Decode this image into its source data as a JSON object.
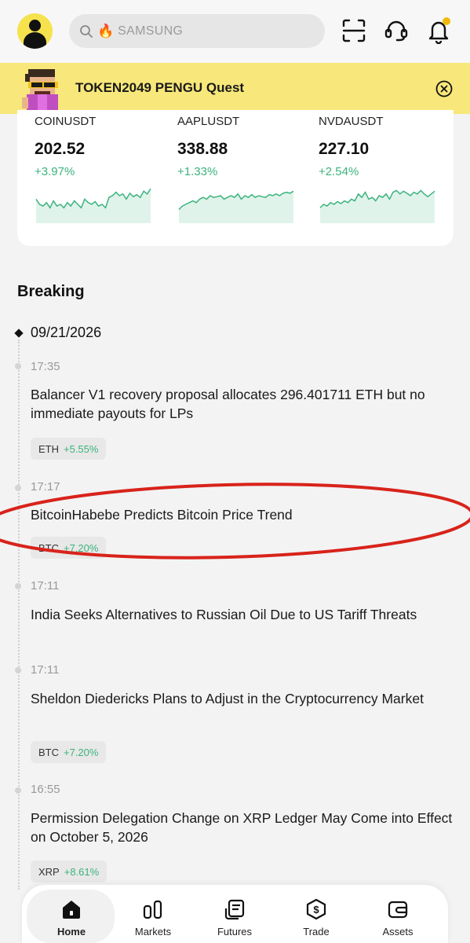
{
  "header": {
    "search_hot_icon": "fire-icon",
    "search_text": "SAMSUNG",
    "icons": [
      "scan-icon",
      "support-headset-icon",
      "bell-icon"
    ],
    "notification_dot_color": "#f0b90b"
  },
  "banner": {
    "text": "TOKEN2049 PENGU Quest",
    "bg_color": "#f8e77a"
  },
  "tickers": [
    {
      "symbol": "COINUSDT",
      "price": "202.52",
      "change": "+3.97%",
      "spark": [
        0.35,
        0.5,
        0.55,
        0.45,
        0.6,
        0.4,
        0.55,
        0.5,
        0.6,
        0.45,
        0.55,
        0.4,
        0.5,
        0.6,
        0.35,
        0.45,
        0.5,
        0.42,
        0.55,
        0.5,
        0.6,
        0.3,
        0.25,
        0.15,
        0.25,
        0.2,
        0.35,
        0.18,
        0.28,
        0.22,
        0.3,
        0.12,
        0.2,
        0.05
      ]
    },
    {
      "symbol": "AAPLUSDT",
      "price": "338.88",
      "change": "+1.33%",
      "spark": [
        0.65,
        0.55,
        0.5,
        0.45,
        0.4,
        0.45,
        0.35,
        0.3,
        0.35,
        0.25,
        0.3,
        0.28,
        0.25,
        0.35,
        0.3,
        0.25,
        0.3,
        0.2,
        0.35,
        0.25,
        0.3,
        0.22,
        0.3,
        0.25,
        0.28,
        0.3,
        0.22,
        0.25,
        0.2,
        0.25,
        0.18,
        0.15,
        0.18,
        0.12
      ]
    },
    {
      "symbol": "NVDAUSDT",
      "price": "227.10",
      "change": "+2.54%",
      "spark": [
        0.6,
        0.5,
        0.55,
        0.45,
        0.5,
        0.42,
        0.48,
        0.4,
        0.45,
        0.35,
        0.4,
        0.2,
        0.3,
        0.15,
        0.35,
        0.3,
        0.4,
        0.25,
        0.3,
        0.2,
        0.35,
        0.15,
        0.1,
        0.2,
        0.12,
        0.18,
        0.25,
        0.15,
        0.2,
        0.1,
        0.2,
        0.28,
        0.2,
        0.12
      ]
    }
  ],
  "section_title": "Breaking",
  "date": "09/21/2026",
  "news": [
    {
      "time": "17:35",
      "headline": "Balancer V1 recovery proposal allocates 296.401711 ETH but no immediate payouts for LPs",
      "tag": {
        "symbol": "ETH",
        "change": "+5.55%"
      }
    },
    {
      "time": "17:17",
      "headline": "BitcoinHabebe Predicts Bitcoin Price Trend",
      "tag": {
        "symbol": "BTC",
        "change": "+7.20%"
      }
    },
    {
      "time": "17:11",
      "headline": "India Seeks Alternatives to Russian Oil Due to US Tariff Threats",
      "tag": null
    },
    {
      "time": "17:11",
      "headline": "Sheldon Diedericks Plans to Adjust in the Cryptocurrency Market",
      "tag": {
        "symbol": "BTC",
        "change": "+7.20%"
      }
    },
    {
      "time": "16:55",
      "headline": "Permission Delegation Change on XRP Ledger May Come into Effect on October 5, 2026",
      "tag": {
        "symbol": "XRP",
        "change": "+8.61%"
      }
    }
  ],
  "nav": {
    "items": [
      {
        "label": "Home",
        "icon": "home-icon",
        "active": true
      },
      {
        "label": "Markets",
        "icon": "markets-bars-icon",
        "active": false
      },
      {
        "label": "Futures",
        "icon": "futures-doc-icon",
        "active": false
      },
      {
        "label": "Trade",
        "icon": "trade-shield-icon",
        "active": false
      },
      {
        "label": "Assets",
        "icon": "wallet-icon",
        "active": false
      }
    ]
  },
  "accent_green": "#3bb37d",
  "annotation_color": "#d8231b"
}
